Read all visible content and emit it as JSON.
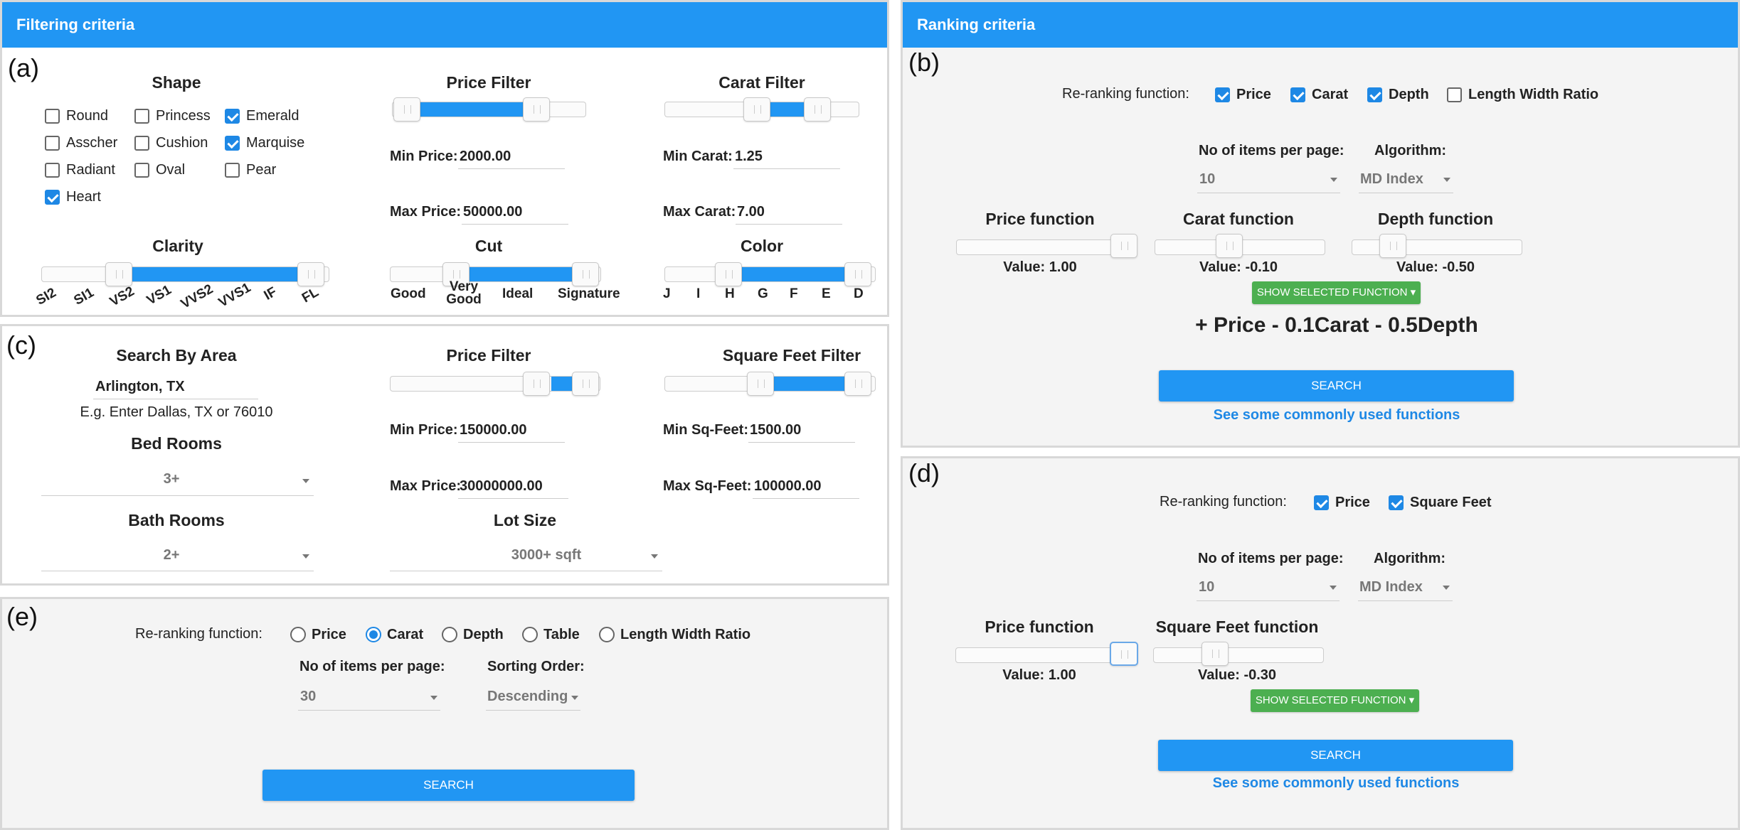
{
  "panel_a": {
    "header": "Filtering criteria",
    "tag": "(a)",
    "shape_title": "Shape",
    "shapes": [
      {
        "label": "Round",
        "checked": false
      },
      {
        "label": "Princess",
        "checked": false
      },
      {
        "label": "Emerald",
        "checked": true
      },
      {
        "label": "Asscher",
        "checked": false
      },
      {
        "label": "Cushion",
        "checked": false
      },
      {
        "label": "Marquise",
        "checked": true
      },
      {
        "label": "Radiant",
        "checked": false
      },
      {
        "label": "Oval",
        "checked": false
      },
      {
        "label": "Pear",
        "checked": false
      },
      {
        "label": "Heart",
        "checked": true
      }
    ],
    "price_title": "Price Filter",
    "min_price_label": "Min Price:",
    "min_price": "2000.00",
    "max_price_label": "Max Price:",
    "max_price": "50000.00",
    "carat_title": "Carat Filter",
    "min_carat_label": "Min Carat:",
    "min_carat": "1.25",
    "max_carat_label": "Max Carat:",
    "max_carat": "7.00",
    "clarity_title": "Clarity",
    "clarity_ticks": [
      "SI2",
      "SI1",
      "VS2",
      "VS1",
      "VVS2",
      "VVS1",
      "IF",
      "FL"
    ],
    "cut_title": "Cut",
    "cut_ticks": [
      "Good",
      "Very Good",
      "Ideal",
      "Signature"
    ],
    "color_title": "Color",
    "color_ticks": [
      "J",
      "I",
      "H",
      "G",
      "F",
      "E",
      "D"
    ]
  },
  "panel_b": {
    "header": "Ranking criteria",
    "tag": "(b)",
    "rerank_label": "Re-ranking function:",
    "options": [
      {
        "label": "Price",
        "checked": true
      },
      {
        "label": "Carat",
        "checked": true
      },
      {
        "label": "Depth",
        "checked": true
      },
      {
        "label": "Length Width Ratio",
        "checked": false
      }
    ],
    "per_page_label": "No of items per page:",
    "per_page": "10",
    "algorithm_label": "Algorithm:",
    "algorithm": "MD Index",
    "functions": [
      {
        "title": "Price function",
        "value": "Value: 1.00"
      },
      {
        "title": "Carat function",
        "value": "Value: -0.10"
      },
      {
        "title": "Depth function",
        "value": "Value: -0.50"
      }
    ],
    "show_btn": "SHOW SELECTED FUNCTION ▾",
    "formula": "+ Price - 0.1Carat - 0.5Depth",
    "search": "SEARCH",
    "link": "See some commonly used functions"
  },
  "panel_c": {
    "tag": "(c)",
    "area_title": "Search By Area",
    "area_value": "Arlington, TX",
    "area_hint": "E.g. Enter Dallas, TX or 76010",
    "bed_title": "Bed Rooms",
    "bed_value": "3+",
    "bath_title": "Bath Rooms",
    "bath_value": "2+",
    "price_title": "Price Filter",
    "min_price_label": "Min Price:",
    "min_price": "150000.00",
    "max_price_label": "Max Price:",
    "max_price": "30000000.00",
    "lot_title": "Lot Size",
    "lot_value": "3000+ sqft",
    "sqft_title": "Square Feet Filter",
    "min_sqft_label": "Min Sq-Feet:",
    "min_sqft": "1500.00",
    "max_sqft_label": "Max Sq-Feet:",
    "max_sqft": "100000.00"
  },
  "panel_d": {
    "tag": "(d)",
    "rerank_label": "Re-ranking function:",
    "options": [
      {
        "label": "Price",
        "checked": true
      },
      {
        "label": "Square Feet",
        "checked": true
      }
    ],
    "per_page_label": "No of items per page:",
    "per_page": "10",
    "algorithm_label": "Algorithm:",
    "algorithm": "MD Index",
    "functions": [
      {
        "title": "Price function",
        "value": "Value: 1.00"
      },
      {
        "title": "Square Feet function",
        "value": "Value: -0.30"
      }
    ],
    "show_btn": "SHOW SELECTED FUNCTION ▾",
    "search": "SEARCH",
    "link": "See some commonly used functions"
  },
  "panel_e": {
    "tag": "(e)",
    "rerank_label": "Re-ranking function:",
    "options": [
      {
        "label": "Price",
        "checked": false
      },
      {
        "label": "Carat",
        "checked": true
      },
      {
        "label": "Depth",
        "checked": false
      },
      {
        "label": "Table",
        "checked": false
      },
      {
        "label": "Length Width Ratio",
        "checked": false
      }
    ],
    "per_page_label": "No of items per page:",
    "per_page": "30",
    "sort_label": "Sorting Order:",
    "sort": "Descending",
    "search": "SEARCH"
  },
  "colors": {
    "accent": "#2196f3",
    "green": "#4caf50"
  }
}
